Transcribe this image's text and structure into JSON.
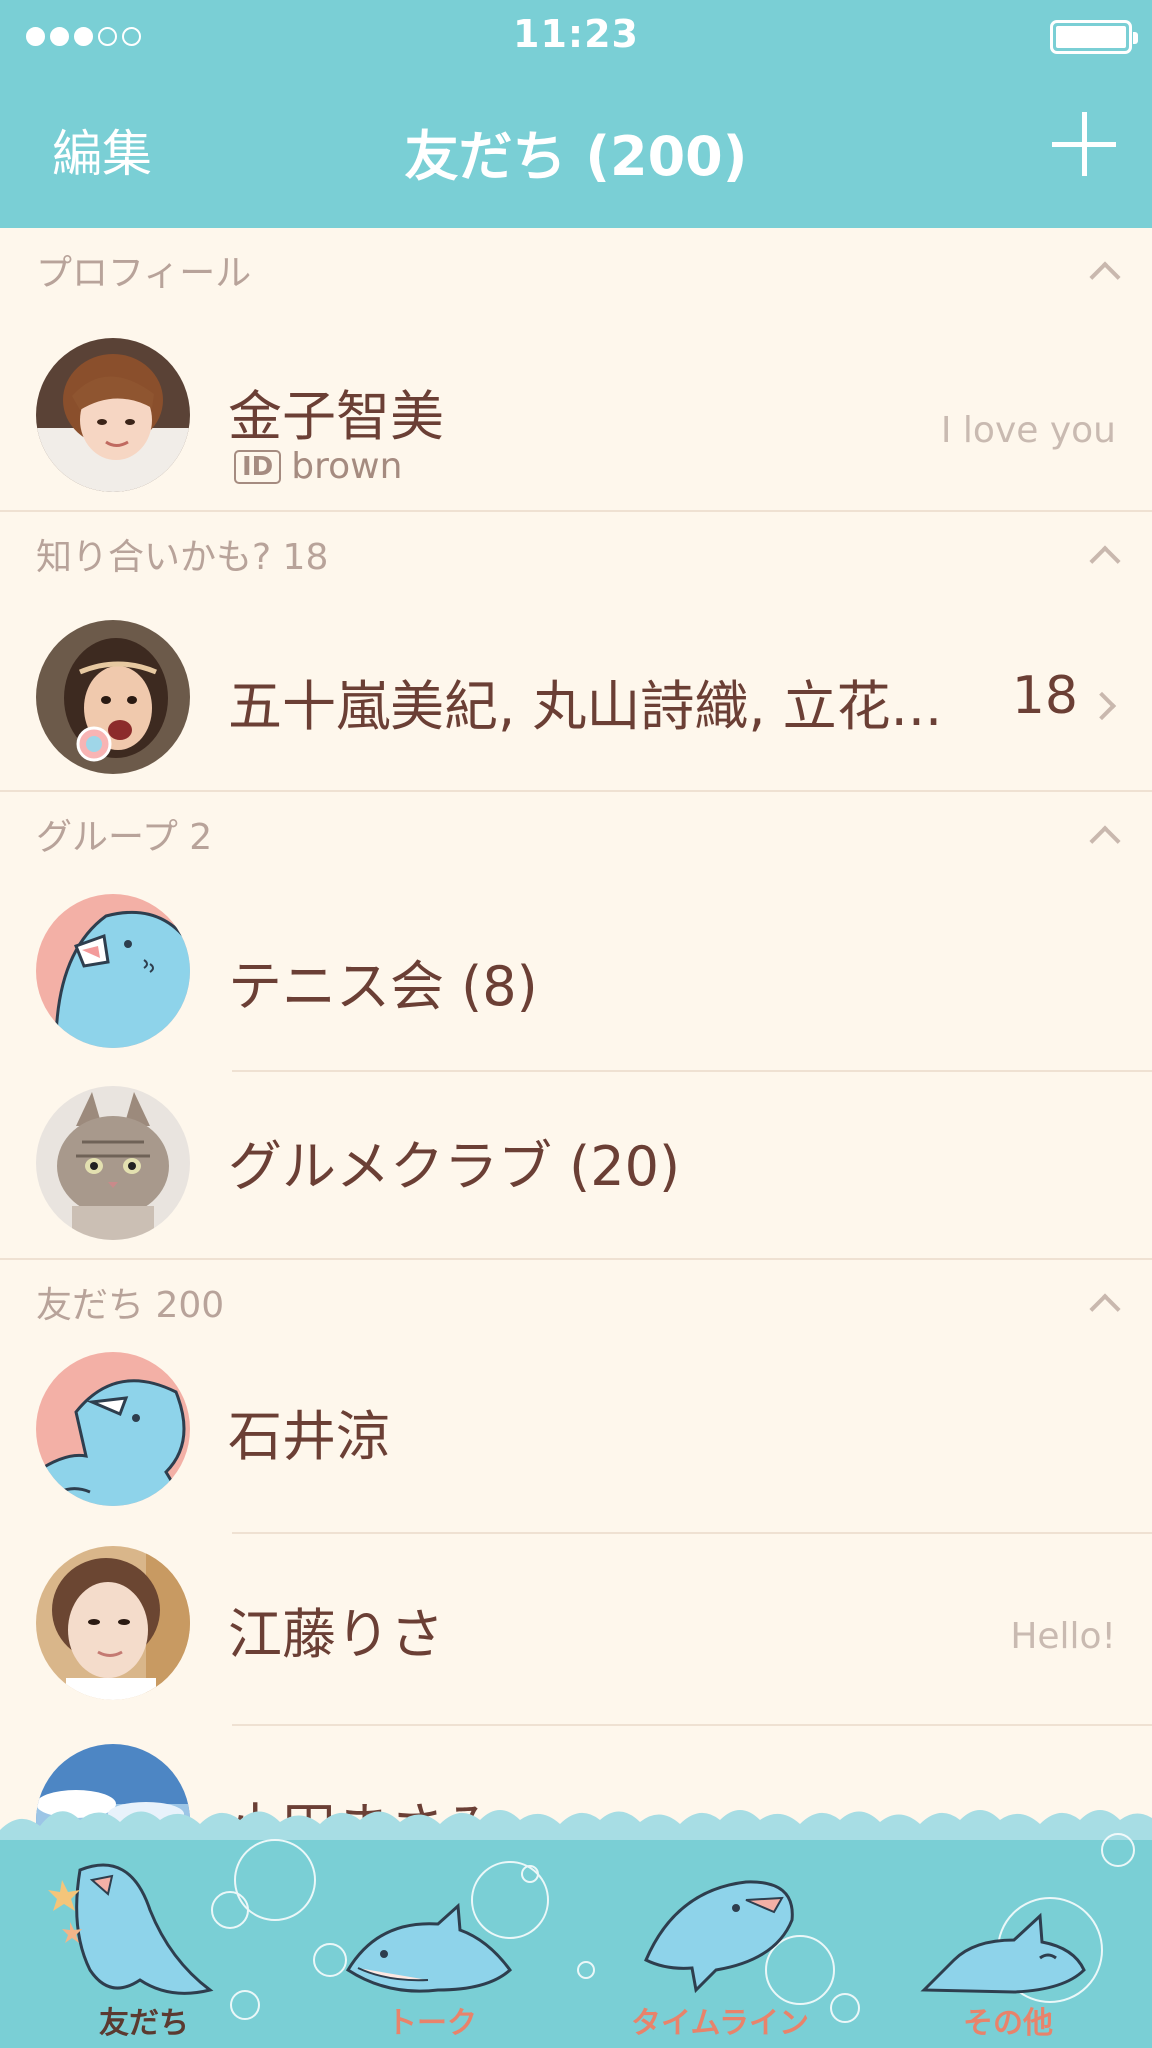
{
  "status_bar": {
    "time": "11:23"
  },
  "nav": {
    "edit": "編集",
    "title": "友だち (200)"
  },
  "sections": {
    "profile": {
      "header": "プロフィール",
      "name": "金子智美",
      "id_badge": "ID",
      "id_value": "brown",
      "status": "I love you"
    },
    "suggested": {
      "header": "知り合いかも? 18",
      "names": "五十嵐美紀, 丸山詩織, 立花...",
      "count": "18"
    },
    "groups": {
      "header": "グループ 2",
      "items": [
        {
          "name": "テニス会 (8)"
        },
        {
          "name": "グルメクラブ (20)"
        }
      ]
    },
    "friends": {
      "header": "友だち 200",
      "items": [
        {
          "name": "石井涼",
          "status": ""
        },
        {
          "name": "江藤りさ",
          "status": "Hello!"
        },
        {
          "name": "小田まさみ",
          "status": ""
        }
      ]
    }
  },
  "tabs": [
    {
      "label": "友だち",
      "icon": "shark-friends-icon",
      "active": true
    },
    {
      "label": "トーク",
      "icon": "shark-talk-icon",
      "active": false
    },
    {
      "label": "タイムライン",
      "icon": "shark-timeline-icon",
      "active": false
    },
    {
      "label": "その他",
      "icon": "shark-other-icon",
      "active": false
    }
  ],
  "colors": {
    "header": "#7acfd5",
    "background": "#fef7ec",
    "text": "#6b3f35",
    "tab_label": "#e8836b"
  }
}
